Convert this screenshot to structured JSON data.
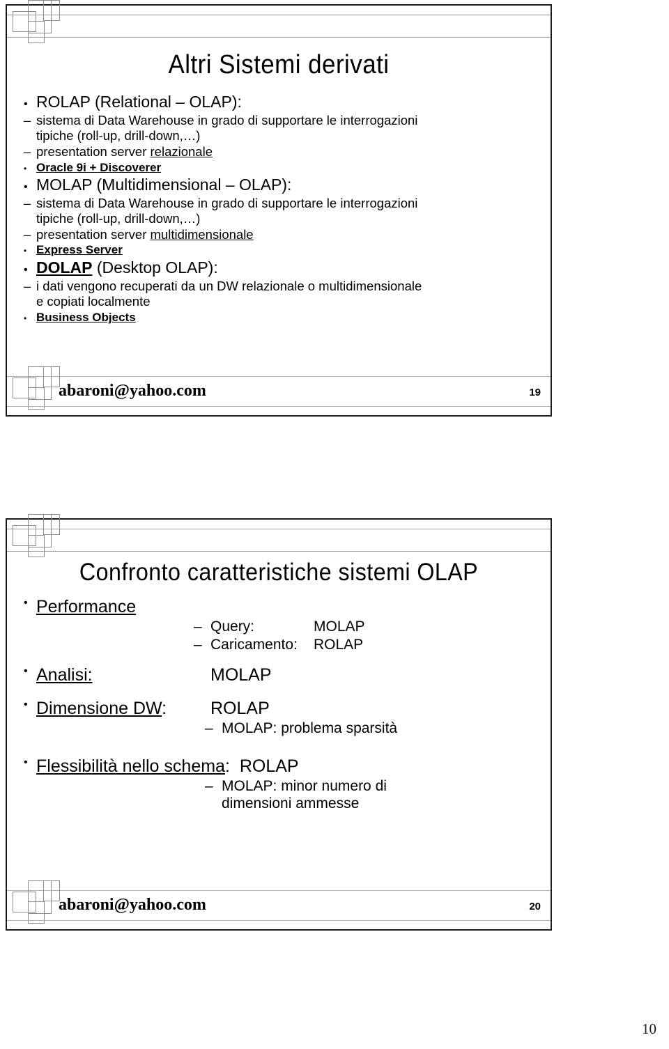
{
  "sheet": {
    "page_number": "10"
  },
  "slides": [
    {
      "title": "Altri Sistemi derivati",
      "footer": {
        "email": "abaroni@yahoo.com",
        "number": "19"
      },
      "bullets": {
        "rolap_heading": "ROLAP (Relational – OLAP):",
        "rolap_sub1_line1": "sistema di Data Warehouse in grado di supportare le interrogazioni",
        "rolap_sub1_line2": "tipiche (roll-up, drill-down,…)",
        "rolap_sub2_plain": "presentation server ",
        "rolap_sub2_underlined": "relazionale",
        "rolap_sub2_item": "Oracle 9i + Discoverer",
        "molap_heading": "MOLAP (Multidimensional – OLAP):",
        "molap_sub1_line1": "sistema di Data Warehouse in grado di supportare le interrogazioni",
        "molap_sub1_line2": "tipiche (roll-up, drill-down,…)",
        "molap_sub2_plain": "presentation server ",
        "molap_sub2_underlined": "multidimensionale",
        "molap_sub2_item": "Express Server",
        "dolap_heading_bold": "DOLAP",
        "dolap_heading_rest": " (Desktop OLAP):",
        "dolap_sub1_line1": "i dati vengono recuperati da un DW relazionale o multidimensionale",
        "dolap_sub1_line2": "e copiati localmente",
        "dolap_sub2_item": "Business Objects"
      }
    },
    {
      "title": "Confronto caratteristiche sistemi OLAP",
      "footer": {
        "email": "abaroni@yahoo.com",
        "number": "20"
      },
      "rows": [
        {
          "label": "Performance",
          "label_underlined": true,
          "value": "",
          "subs": [
            {
              "dash": "–",
              "label": "Query:",
              "value": "MOLAP"
            },
            {
              "dash": "–",
              "label": "Caricamento:",
              "value": "ROLAP"
            }
          ]
        },
        {
          "label": "Analisi:",
          "label_underlined": true,
          "value": "MOLAP",
          "subs": []
        },
        {
          "label_underlined_part": "Dimensione DW",
          "label_tail": ":",
          "value": "ROLAP",
          "subs": [
            {
              "dash": "–",
              "label": "MOLAP: problema sparsità",
              "value": ""
            }
          ]
        },
        {
          "label_underlined_part": "Flessibilità nello schema",
          "label_tail": ":",
          "value": "ROLAP",
          "subs": [
            {
              "dash": "–",
              "label": "MOLAP: minor numero di",
              "value": ""
            },
            {
              "dash": "",
              "label": "dimensioni ammesse",
              "value": ""
            }
          ]
        }
      ]
    }
  ]
}
